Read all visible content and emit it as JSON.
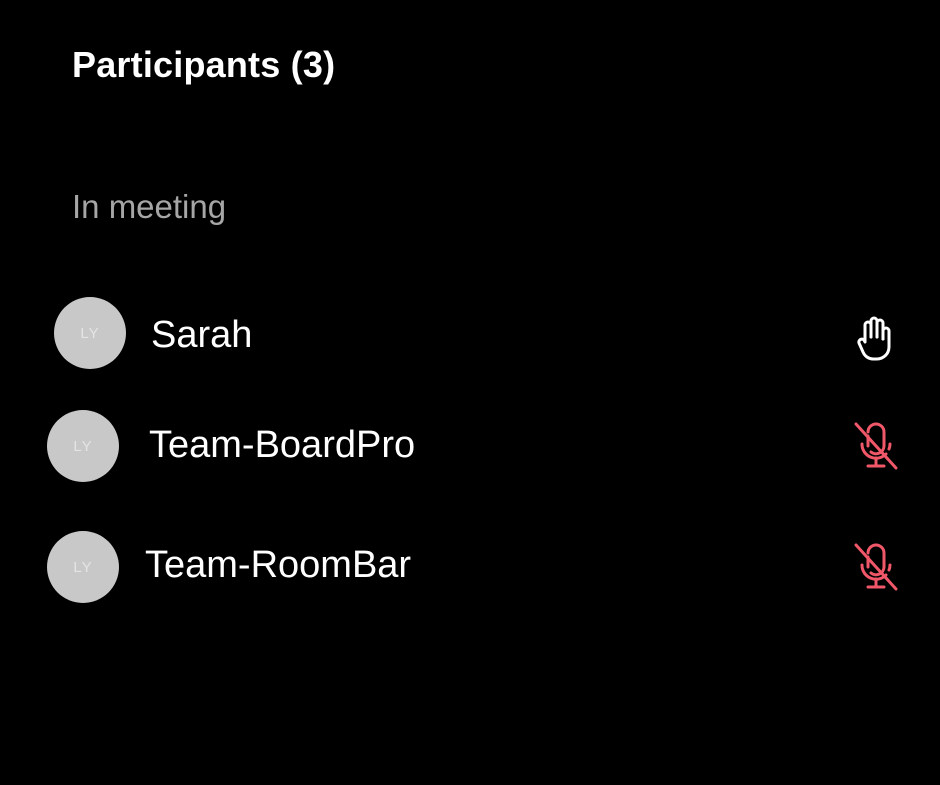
{
  "panel": {
    "title": "Participants (3)",
    "section_label": "In meeting"
  },
  "participants": [
    {
      "name": "Sarah",
      "initials": "LY",
      "status_icon": "raised-hand-icon"
    },
    {
      "name": "Team-BoardPro",
      "initials": "LY",
      "status_icon": "microphone-muted-icon"
    },
    {
      "name": "Team-RoomBar",
      "initials": "LY",
      "status_icon": "microphone-muted-icon"
    }
  ],
  "colors": {
    "background": "#000000",
    "text": "#ffffff",
    "secondary_text": "#a6a6a6",
    "avatar": "#c8c8c8",
    "muted_icon": "#f0586a"
  }
}
